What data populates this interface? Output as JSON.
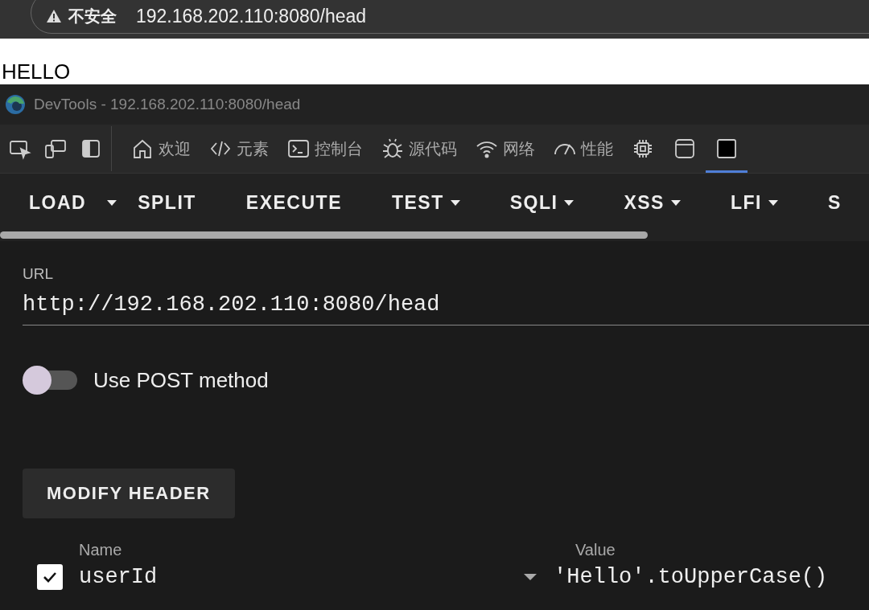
{
  "browser": {
    "security_label": "不安全",
    "address": "192.168.202.110:8080/head"
  },
  "page": {
    "text": "HELLO"
  },
  "devtools": {
    "title": "DevTools - 192.168.202.110:8080/head",
    "tabs": [
      {
        "label": "欢迎",
        "selected": false
      },
      {
        "label": "元素",
        "selected": false
      },
      {
        "label": "控制台",
        "selected": false
      },
      {
        "label": "源代码",
        "selected": false
      },
      {
        "label": "网络",
        "selected": false
      },
      {
        "label": "性能",
        "selected": false
      },
      {
        "selected": false
      },
      {
        "selected": false
      },
      {
        "selected": true
      }
    ]
  },
  "hackbar": {
    "menu": [
      {
        "label": "LOAD",
        "kind": "split"
      },
      {
        "label": "SPLIT",
        "kind": "plain"
      },
      {
        "label": "EXECUTE",
        "kind": "plain"
      },
      {
        "label": "TEST",
        "kind": "dropdown"
      },
      {
        "label": "SQLI",
        "kind": "dropdown"
      },
      {
        "label": "XSS",
        "kind": "dropdown"
      },
      {
        "label": "LFI",
        "kind": "dropdown"
      },
      {
        "label": "S",
        "kind": "plain"
      }
    ],
    "url_label": "URL",
    "url": "http://192.168.202.110:8080/head",
    "post": {
      "label": "Use POST method",
      "on": false
    },
    "modify_button": "MODIFY HEADER",
    "headers": {
      "name_label": "Name",
      "value_label": "Value",
      "rows": [
        {
          "checked": true,
          "name": "userId",
          "value": "'Hello'.toUpperCase()"
        }
      ]
    }
  }
}
